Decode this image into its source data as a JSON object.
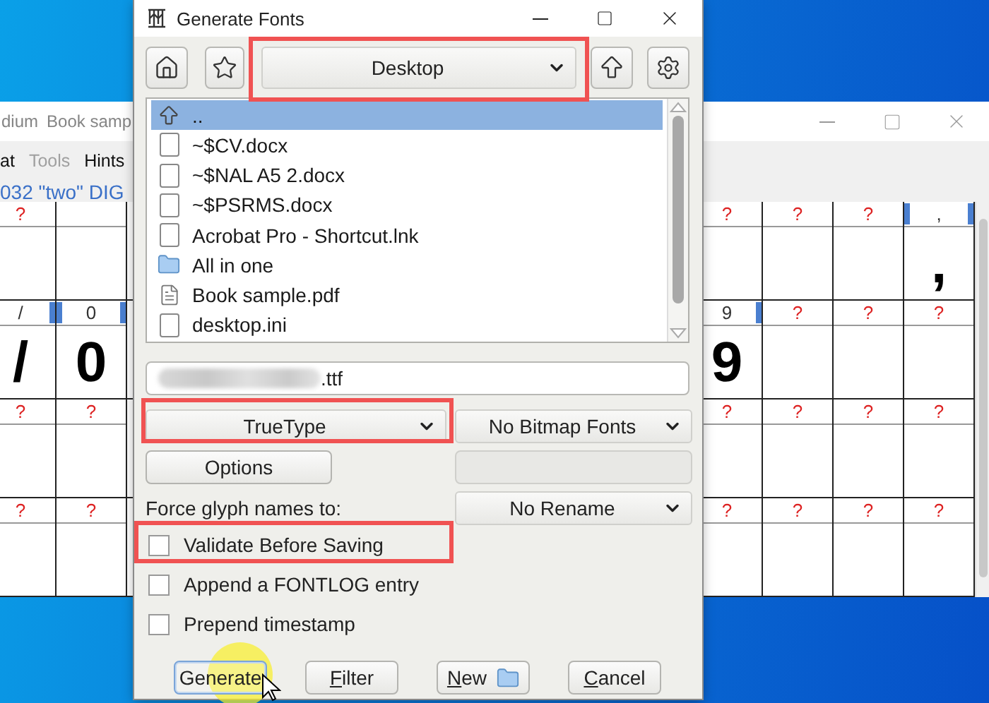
{
  "background_window": {
    "title_parts": [
      "dium",
      "Book samp"
    ],
    "menu": [
      {
        "label": "at",
        "disabled": false
      },
      {
        "label": "Tools",
        "disabled": true
      },
      {
        "label": "Hints",
        "disabled": false
      }
    ],
    "info": "032 \"two\" DIG",
    "rows": [
      {
        "left": [
          {
            "kind": "missing",
            "label": "?",
            "marked": false
          },
          {
            "kind": "blank",
            "marked": false
          }
        ],
        "right": [
          {
            "kind": "missing",
            "label": "?",
            "marked": false
          },
          {
            "kind": "missing",
            "label": "?",
            "marked": false
          },
          {
            "kind": "missing",
            "label": "?",
            "marked": false
          },
          {
            "kind": "glyph",
            "label": ",",
            "glyph": ",",
            "marked": true
          }
        ]
      },
      {
        "left": [
          {
            "kind": "glyph",
            "label": "/",
            "glyph": "/",
            "marked": true
          },
          {
            "kind": "glyph",
            "label": "0",
            "glyph": "0",
            "marked": true
          }
        ],
        "right": [
          {
            "kind": "glyph",
            "label": "9",
            "glyph": "9",
            "marked": true
          },
          {
            "kind": "missing",
            "label": "?",
            "marked": false
          },
          {
            "kind": "missing",
            "label": "?",
            "marked": false
          },
          {
            "kind": "missing",
            "label": "?",
            "marked": false
          }
        ]
      },
      {
        "left": [
          {
            "kind": "missing",
            "label": "?",
            "marked": false
          },
          {
            "kind": "missing",
            "label": "?",
            "marked": false
          }
        ],
        "right": [
          {
            "kind": "missing",
            "label": "?",
            "marked": false
          },
          {
            "kind": "missing",
            "label": "?",
            "marked": false
          },
          {
            "kind": "missing",
            "label": "?",
            "marked": false
          },
          {
            "kind": "missing",
            "label": "?",
            "marked": false
          }
        ]
      },
      {
        "left": [
          {
            "kind": "missing",
            "label": "?",
            "marked": false
          },
          {
            "kind": "missing",
            "label": "?",
            "marked": false
          }
        ],
        "right": [
          {
            "kind": "missing",
            "label": "?",
            "marked": false
          },
          {
            "kind": "missing",
            "label": "?",
            "marked": false
          },
          {
            "kind": "missing",
            "label": "?",
            "marked": false
          },
          {
            "kind": "missing",
            "label": "?",
            "marked": false
          }
        ]
      }
    ]
  },
  "dialog": {
    "title": "Generate Fonts",
    "location": "Desktop",
    "files": [
      {
        "kind": "parent",
        "name": "..",
        "selected": true
      },
      {
        "kind": "file",
        "name": "~$CV.docx",
        "selected": false
      },
      {
        "kind": "file",
        "name": "~$NAL A5 2.docx",
        "selected": false
      },
      {
        "kind": "file",
        "name": "~$PSRMS.docx",
        "selected": false
      },
      {
        "kind": "file",
        "name": "Acrobat Pro - Shortcut.lnk",
        "selected": false
      },
      {
        "kind": "folder",
        "name": "All in one",
        "selected": false
      },
      {
        "kind": "document",
        "name": "Book sample.pdf",
        "selected": false
      },
      {
        "kind": "file",
        "name": "desktop.ini",
        "selected": false
      }
    ],
    "filename": ".ttf",
    "format": "TrueType",
    "bitmap": "No Bitmap Fonts",
    "options_button": "Options",
    "force_label": "Force glyph names to:",
    "rename": "No Rename",
    "checkboxes": [
      {
        "label": "Validate Before Saving",
        "checked": false
      },
      {
        "label": "Append a FONTLOG entry",
        "checked": false
      },
      {
        "label": "Prepend timestamp",
        "checked": false
      }
    ],
    "buttons": [
      {
        "label": "Generate",
        "default": true,
        "mnemonic": false,
        "folder_icon": false
      },
      {
        "label": "Filter",
        "default": false,
        "mnemonic": true,
        "folder_icon": false
      },
      {
        "label": "New",
        "default": false,
        "mnemonic": true,
        "folder_icon": true
      },
      {
        "label": "Cancel",
        "default": false,
        "mnemonic": true,
        "folder_icon": false
      }
    ]
  }
}
